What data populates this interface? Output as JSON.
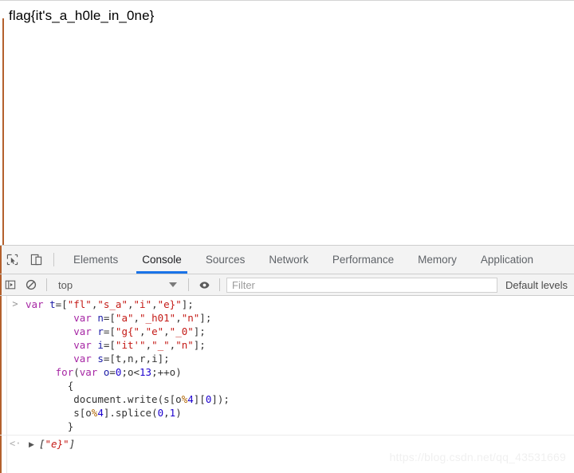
{
  "page": {
    "flag_text": "flag{it's_a_h0le_in_0ne}"
  },
  "devtools": {
    "tabs": [
      {
        "label": "Elements",
        "active": false
      },
      {
        "label": "Console",
        "active": true
      },
      {
        "label": "Sources",
        "active": false
      },
      {
        "label": "Network",
        "active": false
      },
      {
        "label": "Performance",
        "active": false
      },
      {
        "label": "Memory",
        "active": false
      },
      {
        "label": "Application",
        "active": false
      }
    ],
    "tabbar_icons": [
      {
        "name": "inspect-element-icon"
      },
      {
        "name": "device-toolbar-icon"
      }
    ],
    "filterbar": {
      "sidebar_toggle_icon": "console-sidebar-icon",
      "clear_console_icon": "clear-console-icon",
      "context_selector": "top",
      "live_expression_icon": "eye-icon",
      "filter_placeholder": "Filter",
      "filter_value": "",
      "log_levels": "Default levels"
    },
    "console": {
      "prompt_marker": ">",
      "result_marker": "<·",
      "disclosure_marker": "▶",
      "input_lines": [
        [
          {
            "t": "var",
            "c": "kw"
          },
          {
            "t": " ",
            "c": "plain"
          },
          {
            "t": "t",
            "c": "var"
          },
          {
            "t": "=[",
            "c": "punc"
          },
          {
            "t": "\"fl\"",
            "c": "str"
          },
          {
            "t": ",",
            "c": "punc"
          },
          {
            "t": "\"s_a\"",
            "c": "str"
          },
          {
            "t": ",",
            "c": "punc"
          },
          {
            "t": "\"i\"",
            "c": "str"
          },
          {
            "t": ",",
            "c": "punc"
          },
          {
            "t": "\"e}\"",
            "c": "str"
          },
          {
            "t": "];",
            "c": "punc"
          }
        ],
        [
          {
            "t": "        ",
            "c": "plain"
          },
          {
            "t": "var",
            "c": "kw"
          },
          {
            "t": " ",
            "c": "plain"
          },
          {
            "t": "n",
            "c": "var"
          },
          {
            "t": "=[",
            "c": "punc"
          },
          {
            "t": "\"a\"",
            "c": "str"
          },
          {
            "t": ",",
            "c": "punc"
          },
          {
            "t": "\"_h01\"",
            "c": "str"
          },
          {
            "t": ",",
            "c": "punc"
          },
          {
            "t": "\"n\"",
            "c": "str"
          },
          {
            "t": "];",
            "c": "punc"
          }
        ],
        [
          {
            "t": "        ",
            "c": "plain"
          },
          {
            "t": "var",
            "c": "kw"
          },
          {
            "t": " ",
            "c": "plain"
          },
          {
            "t": "r",
            "c": "var"
          },
          {
            "t": "=[",
            "c": "punc"
          },
          {
            "t": "\"g{\"",
            "c": "str"
          },
          {
            "t": ",",
            "c": "punc"
          },
          {
            "t": "\"e\"",
            "c": "str"
          },
          {
            "t": ",",
            "c": "punc"
          },
          {
            "t": "\"_0\"",
            "c": "str"
          },
          {
            "t": "];",
            "c": "punc"
          }
        ],
        [
          {
            "t": "        ",
            "c": "plain"
          },
          {
            "t": "var",
            "c": "kw"
          },
          {
            "t": " ",
            "c": "plain"
          },
          {
            "t": "i",
            "c": "var"
          },
          {
            "t": "=[",
            "c": "punc"
          },
          {
            "t": "\"it'\"",
            "c": "str"
          },
          {
            "t": ",",
            "c": "punc"
          },
          {
            "t": "\"_\"",
            "c": "str"
          },
          {
            "t": ",",
            "c": "punc"
          },
          {
            "t": "\"n\"",
            "c": "str"
          },
          {
            "t": "];",
            "c": "punc"
          }
        ],
        [
          {
            "t": "        ",
            "c": "plain"
          },
          {
            "t": "var",
            "c": "kw"
          },
          {
            "t": " ",
            "c": "plain"
          },
          {
            "t": "s",
            "c": "var"
          },
          {
            "t": "=[",
            "c": "punc"
          },
          {
            "t": "t,n,r,i",
            "c": "plain"
          },
          {
            "t": "];",
            "c": "punc"
          }
        ],
        [
          {
            "t": "     ",
            "c": "plain"
          },
          {
            "t": "for",
            "c": "kw"
          },
          {
            "t": "(",
            "c": "punc"
          },
          {
            "t": "var",
            "c": "kw"
          },
          {
            "t": " ",
            "c": "plain"
          },
          {
            "t": "o",
            "c": "var"
          },
          {
            "t": "=",
            "c": "punc"
          },
          {
            "t": "0",
            "c": "num"
          },
          {
            "t": ";o<",
            "c": "punc"
          },
          {
            "t": "13",
            "c": "num"
          },
          {
            "t": ";++o)",
            "c": "punc"
          }
        ],
        [
          {
            "t": "       ",
            "c": "plain"
          },
          {
            "t": "{",
            "c": "punc"
          }
        ],
        [
          {
            "t": "        ",
            "c": "plain"
          },
          {
            "t": "document.write(s[o",
            "c": "plain"
          },
          {
            "t": "%",
            "c": "pct"
          },
          {
            "t": "4",
            "c": "num"
          },
          {
            "t": "][",
            "c": "plain"
          },
          {
            "t": "0",
            "c": "num"
          },
          {
            "t": "]);",
            "c": "plain"
          }
        ],
        [
          {
            "t": "        ",
            "c": "plain"
          },
          {
            "t": "s[o",
            "c": "plain"
          },
          {
            "t": "%",
            "c": "pct"
          },
          {
            "t": "4",
            "c": "num"
          },
          {
            "t": "].splice(",
            "c": "plain"
          },
          {
            "t": "0",
            "c": "num"
          },
          {
            "t": ",",
            "c": "plain"
          },
          {
            "t": "1",
            "c": "num"
          },
          {
            "t": ")",
            "c": "plain"
          }
        ],
        [
          {
            "t": "       ",
            "c": "plain"
          },
          {
            "t": "}",
            "c": "punc"
          }
        ]
      ],
      "result_parts": [
        {
          "t": "[",
          "c": "brk"
        },
        {
          "t": "\"e}\"",
          "c": "str"
        },
        {
          "t": "]",
          "c": "brk"
        }
      ]
    }
  },
  "watermark": "https://blog.csdn.net/qq_43531669",
  "colors": {
    "accent_blue": "#1a73e8",
    "rail_orange": "#b4602c",
    "toolbar_bg": "#f3f3f3",
    "string_red": "#c41a16",
    "keyword_purple": "#a626a4",
    "number_blue": "#1c00cf"
  }
}
